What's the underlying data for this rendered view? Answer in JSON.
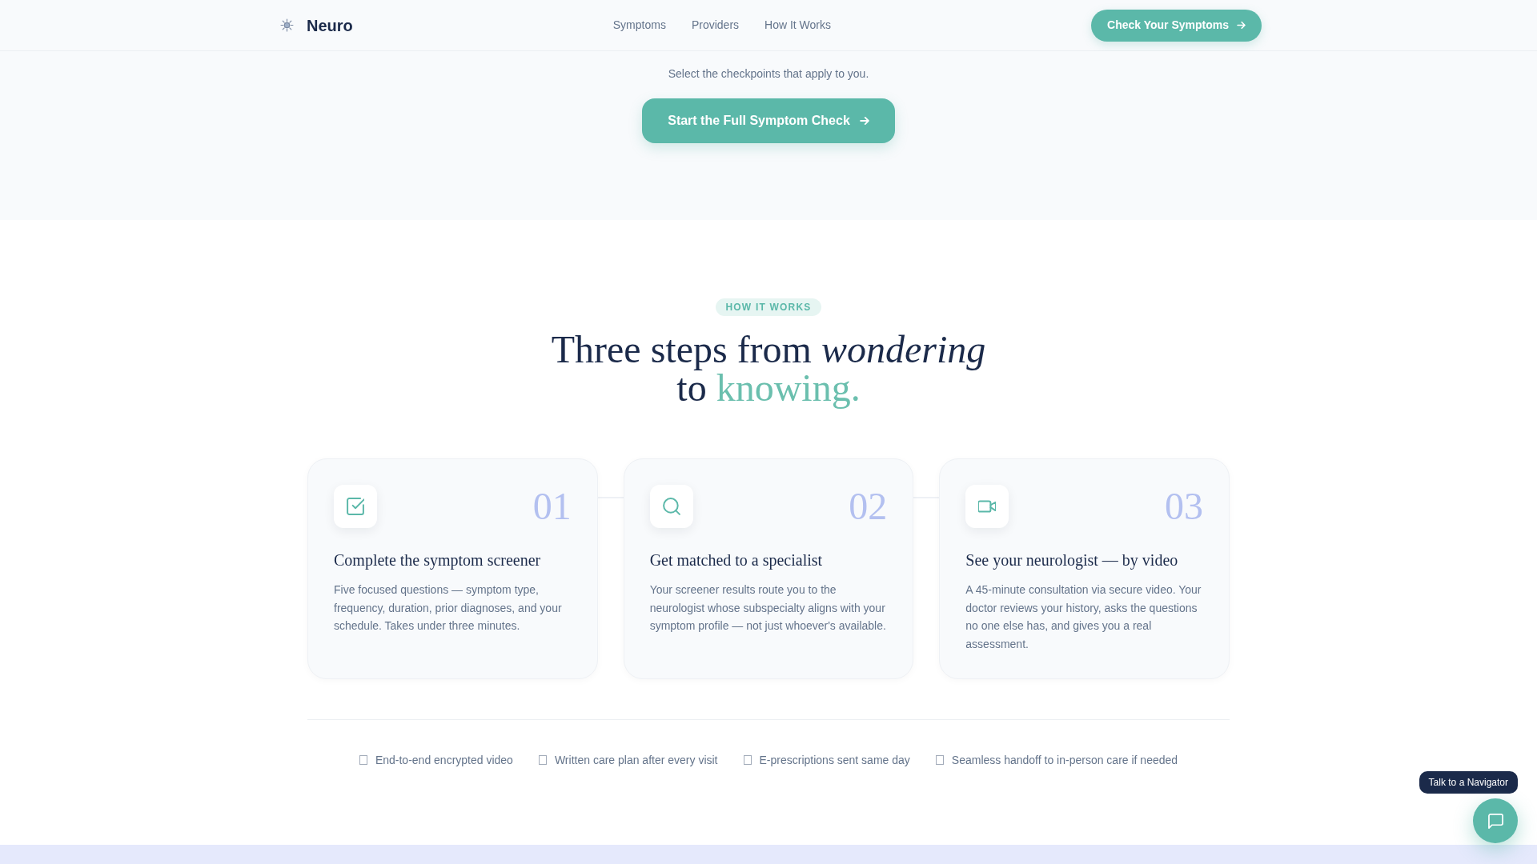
{
  "header": {
    "brand": "Neuro",
    "nav": [
      "Symptoms",
      "Providers",
      "How It Works"
    ],
    "cta": "Check Your Symptoms"
  },
  "hero": {
    "hint": "Select the checkpoints that apply to you.",
    "button": "Start the Full Symptom Check"
  },
  "how_it_works": {
    "badge": "HOW IT WORKS",
    "heading": "Three steps from *wondering* to",
    "heading_highlight": "knowing.",
    "steps": [
      {
        "number": "01",
        "title": "Complete the symptom screener",
        "text": "Five focused questions — symptom type, frequency, duration, prior diagnoses, and your schedule. Takes under three minutes."
      },
      {
        "number": "02",
        "title": "Get matched to a specialist",
        "text": "Your screener results route you to the neurologist whose subspecialty aligns with your symptom profile — not just whoever's available."
      },
      {
        "number": "03",
        "title": "See your neurologist — by video",
        "text": "A 45-minute consultation via secure video. Your doctor reviews your history, asks the questions no one else has, and gives you a real assessment."
      }
    ],
    "features": [
      "End-to-end encrypted video",
      "Written care plan after every visit",
      "E-prescriptions sent same day",
      "Seamless handoff to in-person care if needed"
    ]
  },
  "chat": {
    "tooltip": "Talk to a Navigator"
  }
}
